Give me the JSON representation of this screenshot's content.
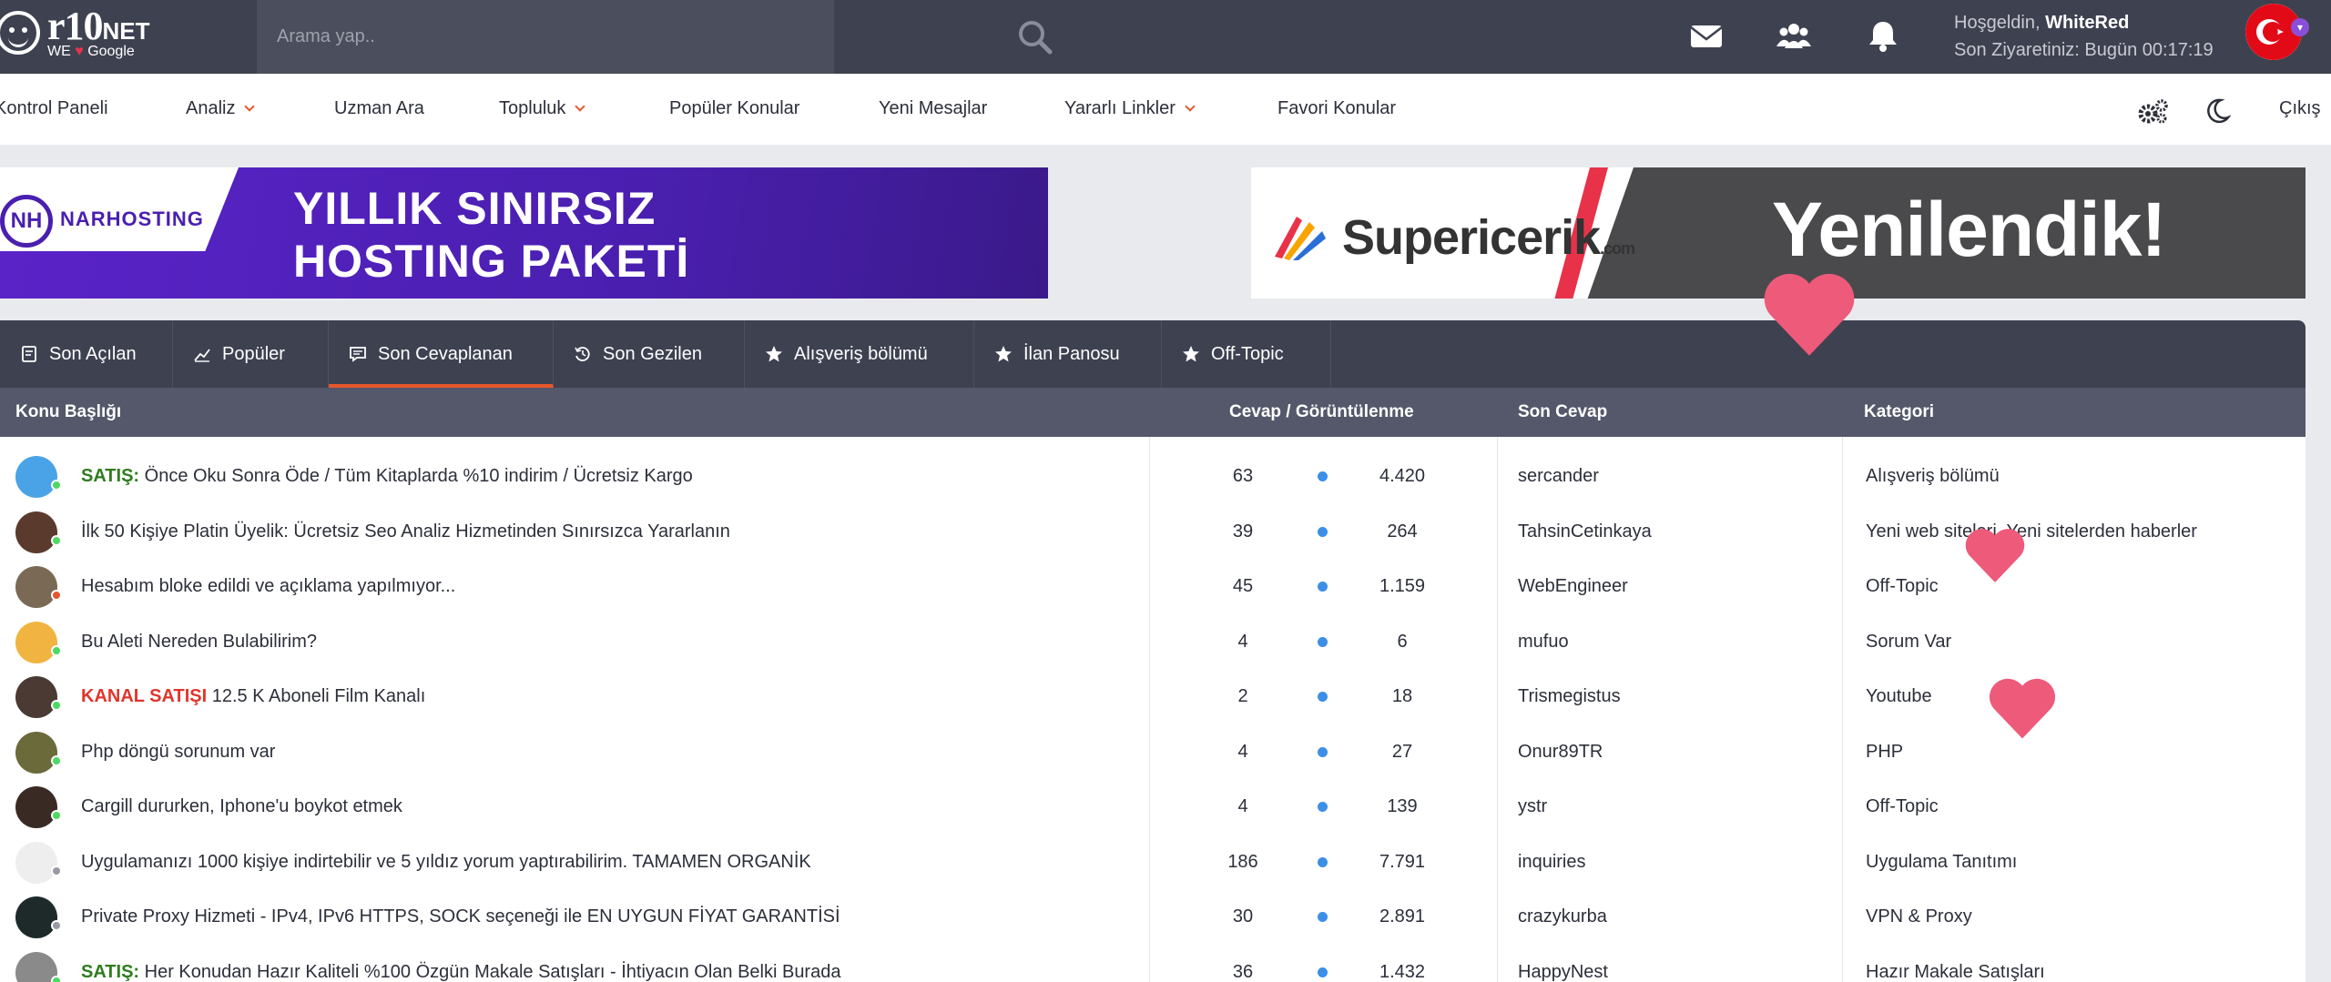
{
  "header": {
    "logo_main": "r10",
    "logo_suffix": "NET",
    "logo_sub_left": "WE",
    "logo_sub_right": "Google",
    "search_placeholder": "Arama yap..",
    "welcome_prefix": "Hoşgeldin,",
    "username": "WhiteRed",
    "last_visit": "Son Ziyaretiniz: Bugün 00:17:19",
    "icons": [
      "mail-icon",
      "users-icon",
      "bell-icon"
    ]
  },
  "nav": {
    "items": [
      {
        "label": "Kontrol Paneli",
        "dropdown": false
      },
      {
        "label": "Analiz",
        "dropdown": true
      },
      {
        "label": "Uzman Ara",
        "dropdown": false
      },
      {
        "label": "Topluluk",
        "dropdown": true
      },
      {
        "label": "Popüler Konular",
        "dropdown": false
      },
      {
        "label": "Yeni Mesajlar",
        "dropdown": false
      },
      {
        "label": "Yararlı Linkler",
        "dropdown": true
      },
      {
        "label": "Favori Konular",
        "dropdown": false
      }
    ],
    "logout": "Çıkış"
  },
  "banners": {
    "left_brand": "NARHOSTING",
    "left_logo": "NH",
    "left_line1": "YILLIK SINIRSIZ",
    "left_line2": "HOSTING PAKETİ",
    "right_brand": "Supericerik",
    "right_brand_suffix": ".com",
    "right_text": "Yenilendik!"
  },
  "tabs": [
    {
      "label": "Son Açılan",
      "icon": "document-icon",
      "active": false
    },
    {
      "label": "Popüler",
      "icon": "trend-icon",
      "active": false
    },
    {
      "label": "Son Cevaplanan",
      "icon": "chat-icon",
      "active": true
    },
    {
      "label": "Son Gezilen",
      "icon": "history-icon",
      "active": false
    },
    {
      "label": "Alışveriş bölümü",
      "icon": "star-icon",
      "active": false
    },
    {
      "label": "İlan Panosu",
      "icon": "star-icon",
      "active": false
    },
    {
      "label": "Off-Topic",
      "icon": "star-icon",
      "active": false
    }
  ],
  "table": {
    "headers": {
      "topic": "Konu Başlığı",
      "counts": "Cevap / Görüntülenme",
      "last_reply": "Son Cevap",
      "category": "Kategori"
    },
    "rows": [
      {
        "prefix": "SATIŞ:",
        "prefix_color": "#2e7d1e",
        "title": "Önce Oku Sonra Öde / Tüm Kitaplarda %10 indirim / Ücretsiz Kargo",
        "replies": "63",
        "views": "4.420",
        "last": "sercander",
        "category": "Alışveriş bölümü",
        "status": "#4cd964",
        "avatar": "#4aa3e6"
      },
      {
        "prefix": "",
        "prefix_color": "",
        "title": "İlk 50 Kişiye Platin Üyelik: Ücretsiz Seo Analiz Hizmetinden Sınırsızca Yararlanın",
        "replies": "39",
        "views": "264",
        "last": "TahsinCetinkaya",
        "category": "Yeni web siteleri, Yeni sitelerden haberler",
        "status": "#4cd964",
        "avatar": "#5b3a2e"
      },
      {
        "prefix": "",
        "prefix_color": "",
        "title": "Hesabım bloke edildi ve açıklama yapılmıyor...",
        "replies": "45",
        "views": "1.159",
        "last": "WebEngineer",
        "category": "Off-Topic",
        "status": "#e8572c",
        "avatar": "#7a6a55"
      },
      {
        "prefix": "",
        "prefix_color": "",
        "title": "Bu Aleti Nereden Bulabilirim?",
        "replies": "4",
        "views": "6",
        "last": "mufuo",
        "category": "Sorum Var",
        "status": "#4cd964",
        "avatar": "#f2b441"
      },
      {
        "prefix": "KANAL SATIŞI",
        "prefix_color": "#e0352b",
        "title": "12.5 K Aboneli Film Kanalı",
        "replies": "2",
        "views": "18",
        "last": "Trismegistus",
        "category": "Youtube",
        "status": "#4cd964",
        "avatar": "#4a3a33"
      },
      {
        "prefix": "",
        "prefix_color": "",
        "title": "Php döngü sorunum var",
        "replies": "4",
        "views": "27",
        "last": "Onur89TR",
        "category": "PHP",
        "status": "#4cd964",
        "avatar": "#6b6a3a"
      },
      {
        "prefix": "",
        "prefix_color": "",
        "title": "Cargill dururken, Iphone'u boykot etmek",
        "replies": "4",
        "views": "139",
        "last": "ystr",
        "category": "Off-Topic",
        "status": "#4cd964",
        "avatar": "#3a2a24"
      },
      {
        "prefix": "",
        "prefix_color": "",
        "title": "Uygulamanızı 1000 kişiye indirtebilir ve 5 yıldız yorum yaptırabilirim. TAMAMEN ORGANİK",
        "replies": "186",
        "views": "7.791",
        "last": "inquiries",
        "category": "Uygulama Tanıtımı",
        "status": "#9a9aa3",
        "avatar": "#eeeeee"
      },
      {
        "prefix": "",
        "prefix_color": "",
        "title": "Private Proxy Hizmeti - IPv4, IPv6 HTTPS, SOCK seçeneği ile EN UYGUN FİYAT GARANTİSİ",
        "replies": "30",
        "views": "2.891",
        "last": "crazykurba",
        "category": "VPN & Proxy",
        "status": "#9a9aa3",
        "avatar": "#1e2a2a"
      },
      {
        "prefix": "SATIŞ:",
        "prefix_color": "#2e7d1e",
        "title": "Her Konudan Hazır Kaliteli %100 Özgün Makale Satışları - İhtiyacın Olan Belki Burada",
        "replies": "36",
        "views": "1.432",
        "last": "HappyNest",
        "category": "Hazır Makale Satışları",
        "status": "#4cd964",
        "avatar": "#8a8a8a"
      }
    ]
  },
  "colors": {
    "topbar": "#3e4150",
    "accent": "#e8572c",
    "reply_dot": "#3d8fe6",
    "heart": "#ee5a7a"
  }
}
